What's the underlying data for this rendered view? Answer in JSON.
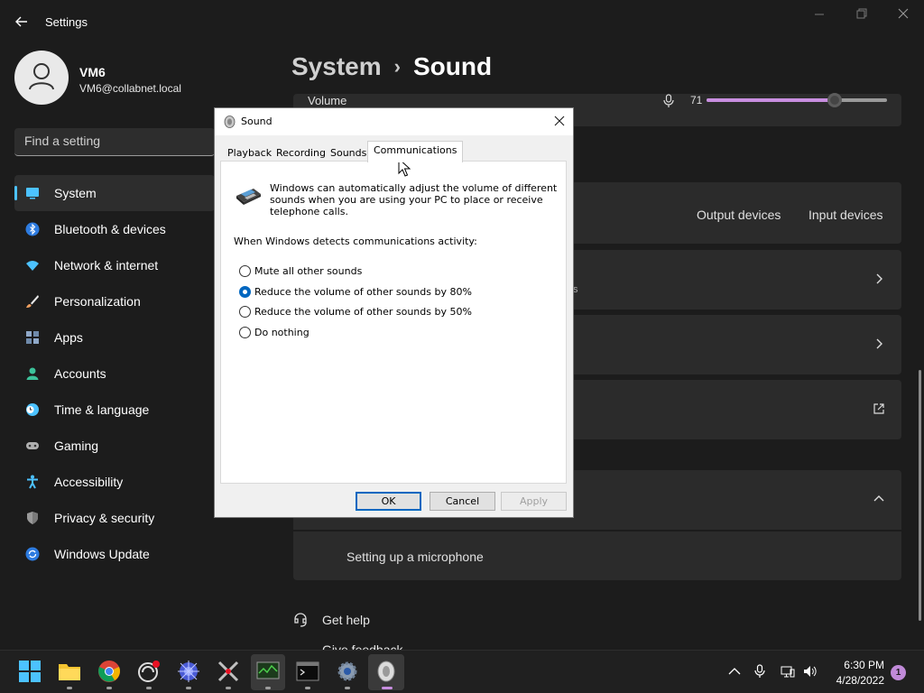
{
  "window": {
    "app_title": "Settings"
  },
  "profile": {
    "name": "VM6",
    "email": "VM6@collabnet.local"
  },
  "search": {
    "placeholder": "Find a setting"
  },
  "nav": {
    "items": [
      {
        "label": "System",
        "icon": "monitor-icon",
        "color": "#4cc2ff"
      },
      {
        "label": "Bluetooth & devices",
        "icon": "bluetooth-icon",
        "color": "#3a8ee6"
      },
      {
        "label": "Network & internet",
        "icon": "wifi-icon",
        "color": "#4cc2ff"
      },
      {
        "label": "Personalization",
        "icon": "brush-icon",
        "color": "#f0a060"
      },
      {
        "label": "Apps",
        "icon": "apps-icon",
        "color": "#8fa8c8"
      },
      {
        "label": "Accounts",
        "icon": "person-icon",
        "color": "#3cc29a"
      },
      {
        "label": "Time & language",
        "icon": "clock-globe-icon",
        "color": "#4cc2ff"
      },
      {
        "label": "Gaming",
        "icon": "gamepad-icon",
        "color": "#b0b0b0"
      },
      {
        "label": "Accessibility",
        "icon": "accessibility-icon",
        "color": "#4cc2ff"
      },
      {
        "label": "Privacy & security",
        "icon": "shield-icon",
        "color": "#a0a0a0"
      },
      {
        "label": "Windows Update",
        "icon": "update-icon",
        "color": "#4cc2ff"
      }
    ]
  },
  "page": {
    "breadcrumb_parent": "System",
    "breadcrumb_sep": "›",
    "breadcrumb_current": "Sound"
  },
  "volume": {
    "label": "Volume",
    "value_text": "71",
    "level": 0.71
  },
  "devices_card": {
    "output_label": "Output devices",
    "input_label": "Input devices"
  },
  "partial_hint": "s",
  "expander": {
    "sub_item": "Setting up a microphone"
  },
  "help": {
    "get_help": "Get help",
    "give_feedback": "Give feedback"
  },
  "dialog": {
    "title": "Sound",
    "tabs": [
      "Playback",
      "Recording",
      "Sounds",
      "Communications"
    ],
    "active_tab": "Communications",
    "intro": "Windows can automatically adjust the volume of different sounds when you are using your PC to place or receive telephone calls.",
    "question": "When Windows detects communications activity:",
    "options": [
      {
        "label": "Mute all other sounds",
        "checked": false
      },
      {
        "label": "Reduce the volume of other sounds by 80%",
        "checked": true
      },
      {
        "label": "Reduce the volume of other sounds by 50%",
        "checked": false
      },
      {
        "label": "Do nothing",
        "checked": false
      }
    ],
    "ok_label": "OK",
    "cancel_label": "Cancel",
    "apply_label": "Apply"
  },
  "taskbar": {
    "apps": [
      "start-icon",
      "file-explorer-icon",
      "chrome-icon",
      "app-icon",
      "network-app-icon",
      "tools-icon",
      "monitor-app-icon",
      "terminal-icon",
      "settings-icon",
      "sound-icon"
    ],
    "time": "6:30 PM",
    "date": "4/28/2022",
    "notification_count": "1"
  },
  "colors": {
    "accent": "#4cc2ff",
    "slider_fill": "#c88ee0",
    "dialog_primary": "#0067c0"
  }
}
